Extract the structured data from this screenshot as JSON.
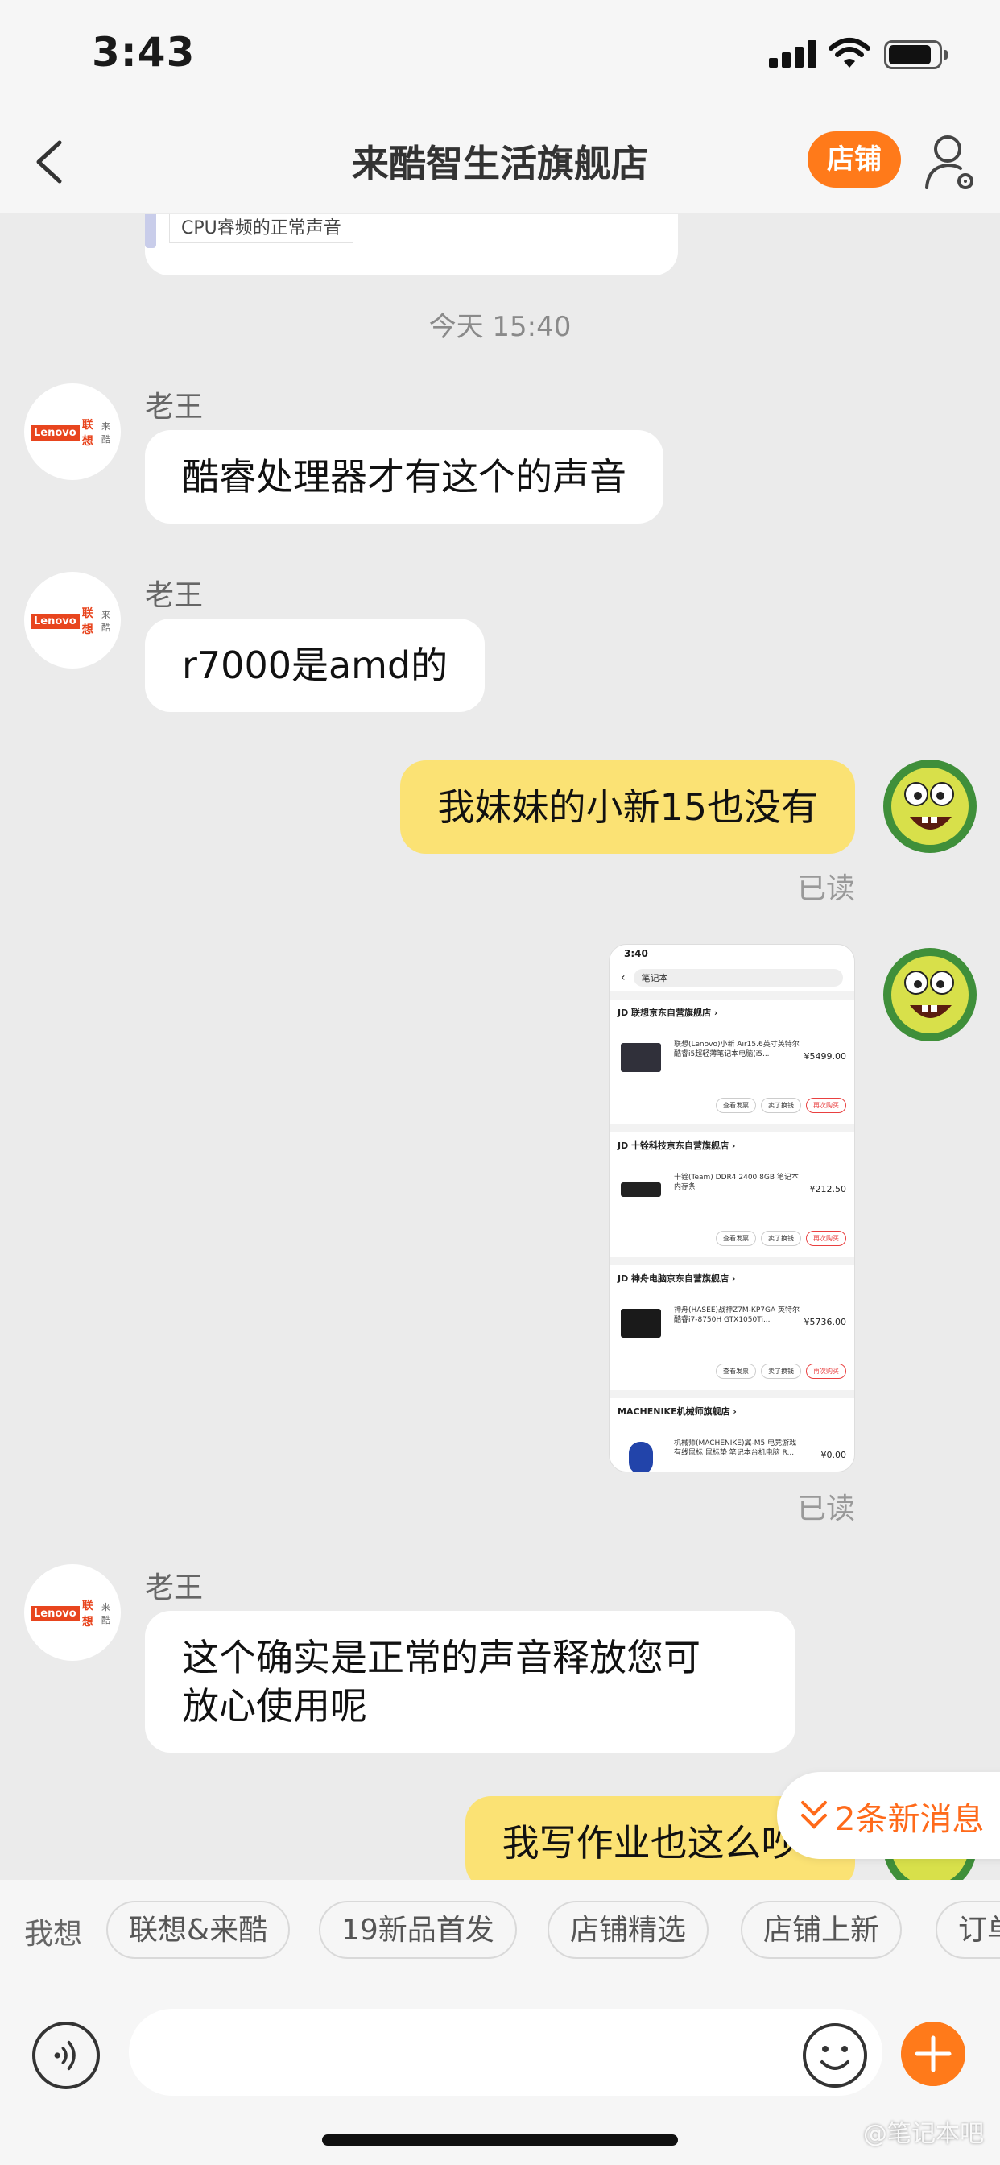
{
  "status_bar": {
    "time": "3:43"
  },
  "nav": {
    "title": "来酷智生活旗舰店",
    "shop_button": "店铺"
  },
  "previous_card": {
    "label": "CPU睿频的正常声音"
  },
  "chat": {
    "timestamp": "今天 15:40",
    "messages": [
      {
        "side": "left",
        "sender": "老王",
        "text": "酷睿处理器才有这个的声音"
      },
      {
        "side": "left",
        "sender": "老王",
        "text": "r7000是amd的"
      },
      {
        "side": "right",
        "text": "我妹妹的小新15也没有",
        "status": "已读"
      },
      {
        "side": "right",
        "type": "image",
        "status": "已读"
      },
      {
        "side": "left",
        "sender": "老王",
        "text_line1": "这个确实是正常的声音释放您可",
        "text_line2": "放心使用呢"
      },
      {
        "side": "right",
        "text": "我写作业也这么吵?"
      }
    ]
  },
  "shared_screenshot": {
    "time": "3:40",
    "search_placeholder": "笔记本",
    "stores": [
      {
        "name": "JD 联想京东自营旗舰店 ›",
        "desc": "联想(Lenovo)小新 Air15.6英寸英特尔酷睿i5超轻薄笔记本电脑(i5...",
        "price": "¥5499.00"
      },
      {
        "name": "JD 十铨科技京东自营旗舰店 ›",
        "desc": "十铨(Team) DDR4 2400 8GB 笔记本内存条",
        "price": "¥212.50"
      },
      {
        "name": "JD 神舟电脑京东自营旗舰店 ›",
        "desc": "神舟(HASEE)战神Z7M-KP7GA 英特尔酷睿i7-8750H GTX1050Ti...",
        "price": "¥5736.00"
      },
      {
        "name": "MACHENIKE机械师旗舰店 ›",
        "desc": "机械师(MACHENIKE)翼-M5 电竞游戏有线鼠标 鼠标垫 笔记本台机电脑 R...",
        "price": "¥0.00"
      }
    ],
    "buttons": [
      "查看发票",
      "卖了换钱",
      "再次购买"
    ]
  },
  "new_messages": {
    "text": "2条新消息"
  },
  "quick_replies": {
    "lead": "我想",
    "chips": [
      "联想&来酷",
      "19新品首发",
      "店铺精选",
      "店铺上新",
      "订单"
    ]
  },
  "watermark": "@笔记本吧",
  "colors": {
    "accent": "#ff7a1a",
    "bubble_right": "#fbe274",
    "background": "#ebebeb"
  }
}
